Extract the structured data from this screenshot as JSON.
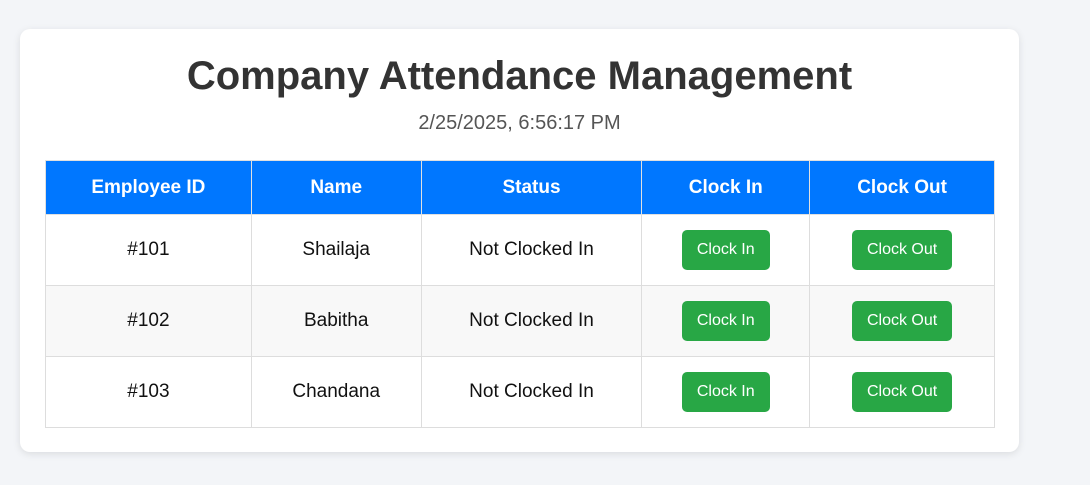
{
  "header": {
    "title": "Company Attendance Management",
    "datetime": "2/25/2025, 6:56:17 PM"
  },
  "table": {
    "columns": [
      "Employee ID",
      "Name",
      "Status",
      "Clock In",
      "Clock Out"
    ],
    "rows": [
      {
        "id": "#101",
        "name": "Shailaja",
        "status": "Not Clocked In",
        "clock_in_label": "Clock In",
        "clock_out_label": "Clock Out"
      },
      {
        "id": "#102",
        "name": "Babitha",
        "status": "Not Clocked In",
        "clock_in_label": "Clock In",
        "clock_out_label": "Clock Out"
      },
      {
        "id": "#103",
        "name": "Chandana",
        "status": "Not Clocked In",
        "clock_in_label": "Clock In",
        "clock_out_label": "Clock Out"
      }
    ]
  },
  "colors": {
    "header_bg": "#0077ff",
    "button_bg": "#28a745",
    "page_bg": "#f3f5f8"
  }
}
